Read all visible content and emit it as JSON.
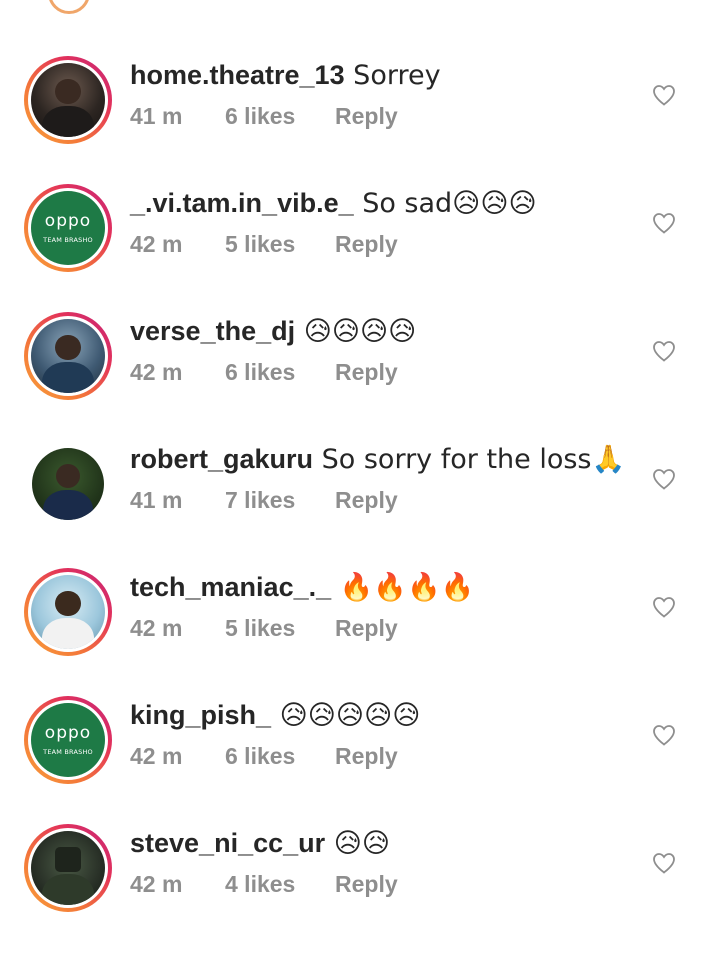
{
  "comments": [
    {
      "username": "home.theatre_13",
      "text": " Sorrey",
      "time": "41 m",
      "likes": "6 likes",
      "reply": "Reply",
      "avatar": "photo-dark",
      "story_ring": true
    },
    {
      "username": "_.vi.tam.in_vib.e_",
      "text": " So sad😥😥😥",
      "time": "42 m",
      "likes": "5 likes",
      "reply": "Reply",
      "avatar": "oppo",
      "avatar_logo": "oppo",
      "avatar_sub": "TEAM BRASHO",
      "story_ring": true
    },
    {
      "username": "verse_the_dj",
      "text": " 😥😥😥😥",
      "time": "42 m",
      "likes": "6 likes",
      "reply": "Reply",
      "avatar": "photo-blue",
      "story_ring": true
    },
    {
      "username": "robert_gakuru",
      "text": " So sorry for the loss🙏",
      "time": "41 m",
      "likes": "7 likes",
      "reply": "Reply",
      "avatar": "photo-green",
      "story_ring": false
    },
    {
      "username": "tech_maniac_._",
      "text": " 🔥🔥🔥🔥",
      "time": "42 m",
      "likes": "5 likes",
      "reply": "Reply",
      "avatar": "photo-light",
      "story_ring": true
    },
    {
      "username": "king_pish_",
      "text": " 😥😥😥😥😥",
      "time": "42 m",
      "likes": "6 likes",
      "reply": "Reply",
      "avatar": "oppo",
      "avatar_logo": "oppo",
      "avatar_sub": "TEAM BRASHO",
      "story_ring": true
    },
    {
      "username": "steve_ni_cc_ur",
      "text": " 😥😥",
      "time": "42 m",
      "likes": "4 likes",
      "reply": "Reply",
      "avatar": "photo-dark",
      "story_ring": true
    }
  ],
  "icons": {
    "like": "heart-outline-icon"
  },
  "colors": {
    "text": "#262626",
    "meta": "#8e8e8e",
    "oppo_green": "#1e7a46"
  }
}
